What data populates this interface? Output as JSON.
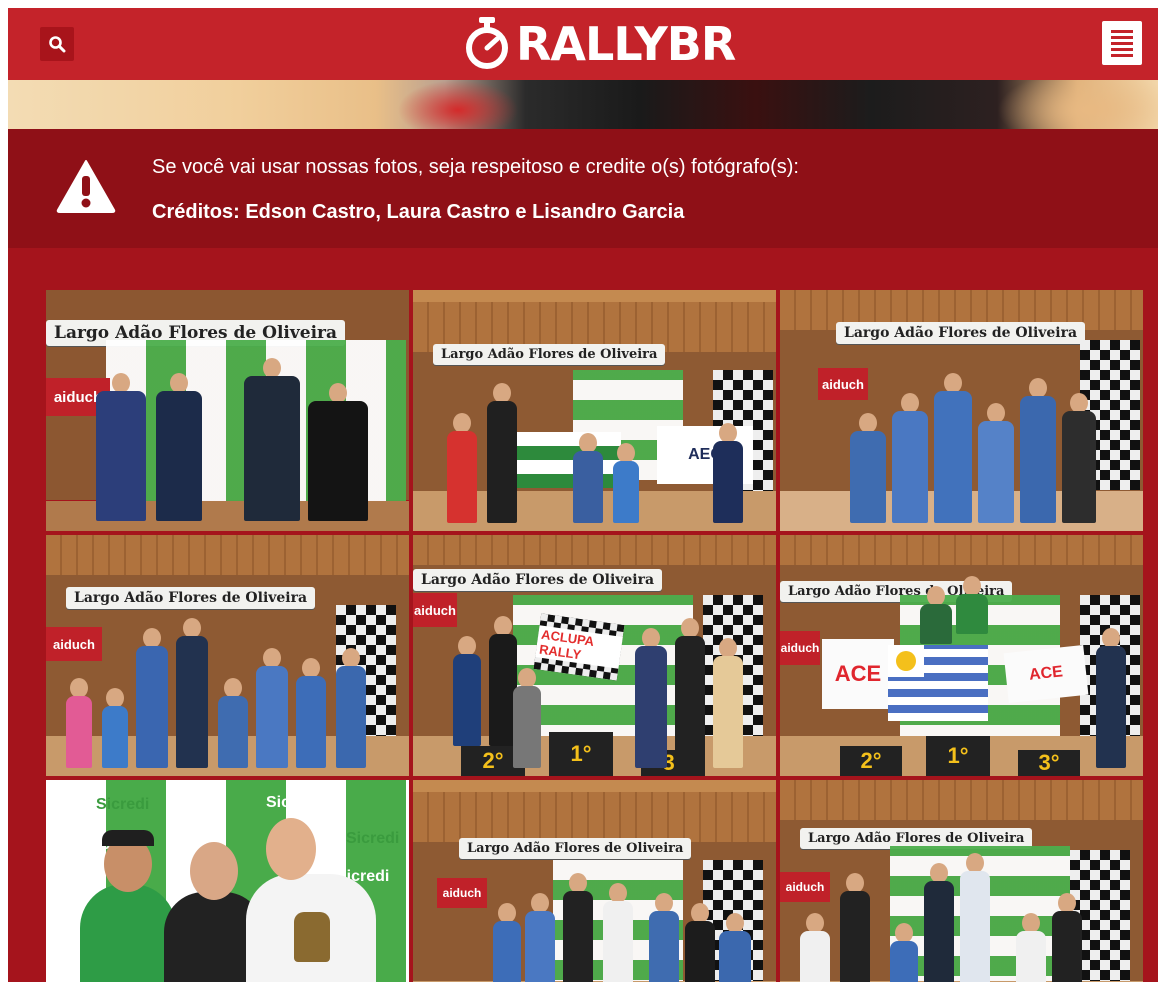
{
  "header": {
    "logo_text": "RALLYBR",
    "colors": {
      "bar": "#c4232a",
      "notice": "#8f1017",
      "page": "#a5141c"
    },
    "icons": {
      "search": "search-icon",
      "menu": "menu-icon",
      "logo": "stopwatch-icon"
    }
  },
  "notice": {
    "icon": "warning-icon",
    "line1": "Se você vai usar nossas fotos, seja respeitoso e credite o(s) fotógrafo(s):",
    "line2": "Créditos: Edson Castro, Laura Castro e Lisandro Garcia"
  },
  "gallery": {
    "sign_text": "Largo Adão Flores de Oliveira",
    "sponsor_text": "Sicredi",
    "ad_text": "aiduch",
    "banner_aec": "AEC",
    "banner_aclupa": "ACLUPA RALLY",
    "banner_ace": "ACE",
    "podium": {
      "first": "1°",
      "second": "2°",
      "third": "3°"
    }
  }
}
